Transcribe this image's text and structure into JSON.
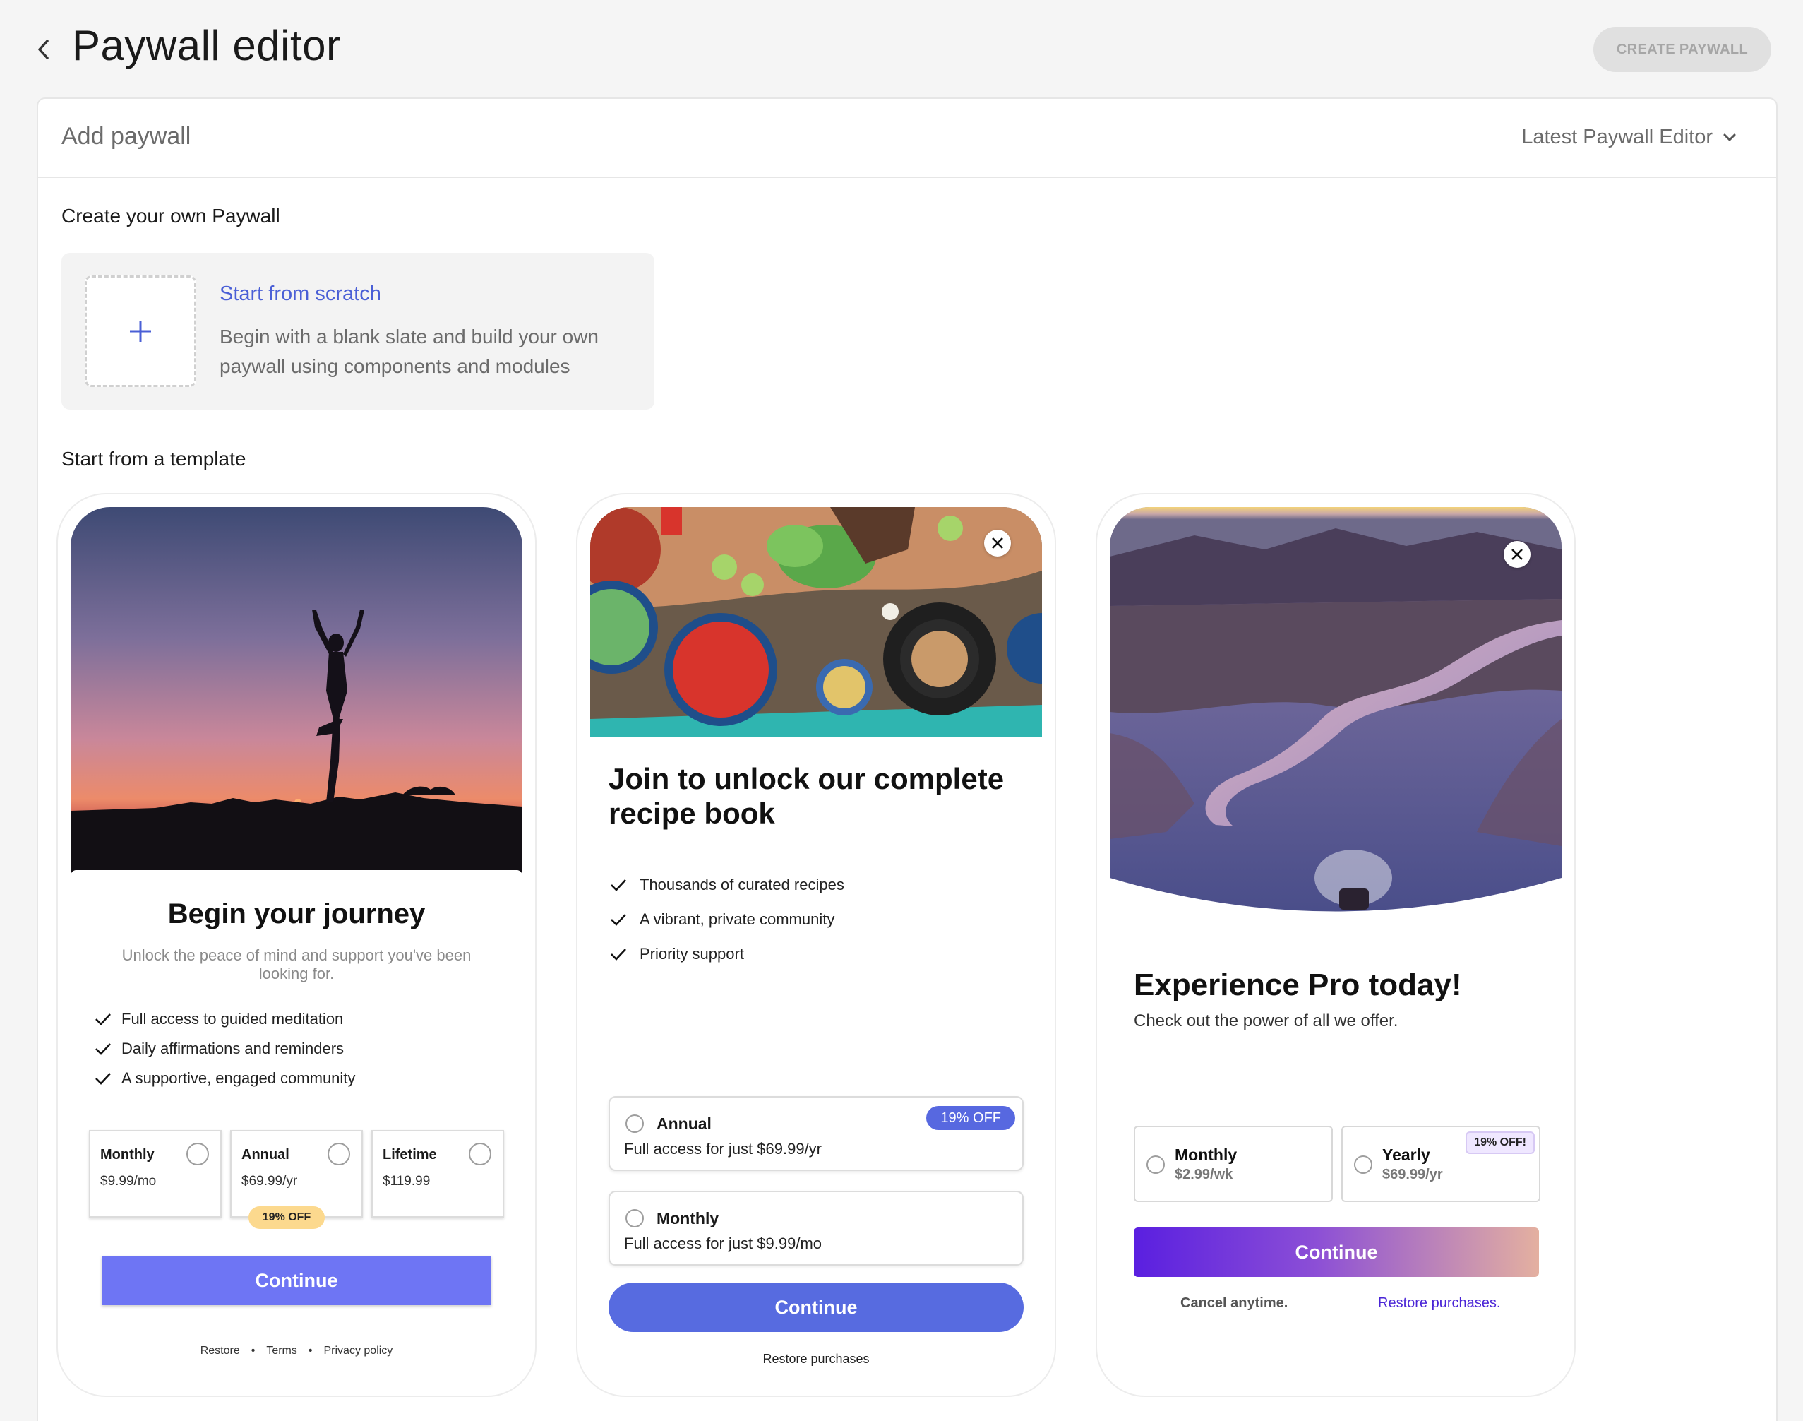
{
  "header": {
    "title": "Paywall editor",
    "create_button": "CREATE PAYWALL"
  },
  "panel": {
    "title": "Add paywall",
    "editor_select": "Latest Paywall Editor",
    "own_section_label": "Create your own Paywall",
    "template_section_label": "Start from a template"
  },
  "scratch": {
    "title": "Start from scratch",
    "description": "Begin with a blank slate and build your own paywall using components and modules"
  },
  "templates": [
    {
      "title": "Begin your journey",
      "subtitle": "Unlock the peace of mind and support you've been looking for.",
      "features": [
        "Full access to guided meditation",
        "Daily affirmations and reminders",
        "A supportive, engaged community"
      ],
      "plans": [
        {
          "name": "Monthly",
          "price": "$9.99/mo"
        },
        {
          "name": "Annual",
          "price": "$69.99/yr"
        },
        {
          "name": "Lifetime",
          "price": "$119.99"
        }
      ],
      "badge": "19% OFF",
      "button": "Continue",
      "footer_links": [
        "Restore",
        "Terms",
        "Privacy policy"
      ],
      "footer_separator": "•"
    },
    {
      "title": "Join to unlock our complete recipe book",
      "features": [
        "Thousands of curated recipes",
        "A vibrant, private community",
        "Priority support"
      ],
      "plans": [
        {
          "name": "Annual",
          "description": "Full access for just $69.99/yr",
          "badge": "19% OFF"
        },
        {
          "name": "Monthly",
          "description": "Full access for just $9.99/mo"
        }
      ],
      "button": "Continue",
      "restore": "Restore purchases"
    },
    {
      "title": "Experience Pro today!",
      "subtitle": "Check out the power of all we offer.",
      "plans": [
        {
          "name": "Monthly",
          "price": "$2.99/wk"
        },
        {
          "name": "Yearly",
          "price": "$69.99/yr",
          "badge": "19% OFF!"
        }
      ],
      "button": "Continue",
      "cancel_text": "Cancel anytime.",
      "restore": "Restore purchases."
    }
  ],
  "colors": {
    "accent_link": "#4a5fd6",
    "template1_button": "#6e75f4",
    "template2_button": "#576be0",
    "template3_gradient_start": "#5a1fe0",
    "template3_gradient_end": "#e4b0a0"
  }
}
